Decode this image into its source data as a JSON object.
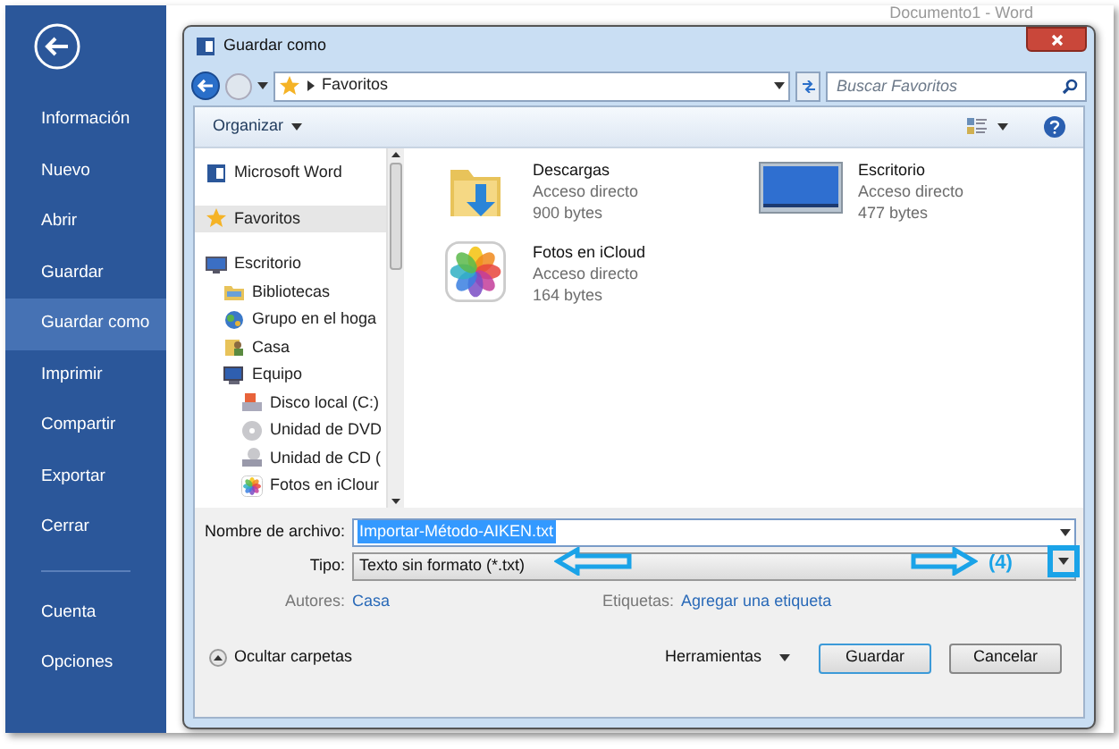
{
  "backstage": {
    "items": [
      {
        "label": "Información",
        "selected": false,
        "kind": "item"
      },
      {
        "label": "Nuevo",
        "selected": false,
        "kind": "item"
      },
      {
        "label": "Abrir",
        "selected": false,
        "kind": "item"
      },
      {
        "label": "Guardar",
        "selected": false,
        "kind": "item"
      },
      {
        "label": "Guardar como",
        "selected": true,
        "kind": "item"
      },
      {
        "label": "Imprimir",
        "selected": false,
        "kind": "item"
      },
      {
        "label": "Compartir",
        "selected": false,
        "kind": "item"
      },
      {
        "label": "Exportar",
        "selected": false,
        "kind": "item"
      },
      {
        "label": "Cerrar",
        "selected": false,
        "kind": "item"
      },
      {
        "kind": "separator"
      },
      {
        "label": "Cuenta",
        "selected": false,
        "kind": "item"
      },
      {
        "label": "Opciones",
        "selected": false,
        "kind": "item"
      }
    ]
  },
  "window": {
    "title": "Documento1 - Word"
  },
  "dialog": {
    "title": "Guardar como",
    "address": "Favoritos",
    "search": {
      "placeholder": "Buscar Favoritos"
    },
    "toolbar": {
      "organize": "Organizar"
    },
    "nav": [
      {
        "label": "Microsoft Word",
        "kind": "word",
        "selected": false
      },
      {
        "label": "Favoritos",
        "kind": "star",
        "selected": true
      },
      {
        "label": "Escritorio",
        "kind": "desktop",
        "selected": false,
        "children": [
          {
            "label": "Bibliotecas",
            "kind": "library",
            "selected": false
          },
          {
            "label": "Grupo en el hoga",
            "kind": "network",
            "selected": false
          },
          {
            "label": "Casa",
            "kind": "user",
            "selected": false
          },
          {
            "label": "Equipo",
            "kind": "computer",
            "selected": false,
            "children": [
              {
                "label": "Disco local (C:)",
                "kind": "disk",
                "selected": false
              },
              {
                "label": "Unidad de DVD",
                "kind": "dvd",
                "selected": false
              },
              {
                "label": "Unidad de CD (",
                "kind": "cd",
                "selected": false
              },
              {
                "label": "Fotos en iClour",
                "kind": "photos",
                "selected": false
              }
            ]
          }
        ]
      }
    ],
    "files": [
      {
        "name": "Descargas",
        "type": "Acceso directo",
        "size": "900 bytes",
        "kind": "downloads"
      },
      {
        "name": "Escritorio",
        "type": "Acceso directo",
        "size": "477 bytes",
        "kind": "desktop"
      },
      {
        "name": "Fotos en iCloud",
        "type": "Acceso directo",
        "size": "164 bytes",
        "kind": "photos"
      }
    ],
    "filename_label": "Nombre de archivo:",
    "filename": "Importar-Método-AIKEN.txt",
    "type_label": "Tipo:",
    "type": "Texto sin formato (*.txt)",
    "authors_label": "Autores:",
    "authors": "Casa",
    "tags_label": "Etiquetas:",
    "tags": "Agregar una etiqueta",
    "hide_folders": "Ocultar carpetas",
    "tools": "Herramientas",
    "save": "Guardar",
    "cancel": "Cancelar",
    "annotation": {
      "label": "(4)"
    }
  }
}
